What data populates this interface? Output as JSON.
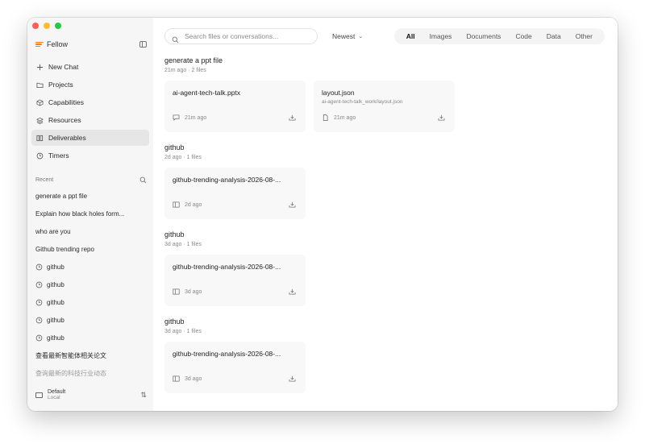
{
  "app": {
    "name": "Fellow"
  },
  "sidebar": {
    "nav": [
      {
        "label": "New Chat",
        "icon": "plus-icon"
      },
      {
        "label": "Projects",
        "icon": "folder-icon"
      },
      {
        "label": "Capabilities",
        "icon": "cube-icon"
      },
      {
        "label": "Resources",
        "icon": "layers-icon"
      },
      {
        "label": "Deliverables",
        "icon": "deliverables-icon",
        "active": true
      },
      {
        "label": "Timers",
        "icon": "clock-icon"
      }
    ],
    "recent_label": "Recent",
    "recent": [
      {
        "label": "generate a ppt file"
      },
      {
        "label": "Explain how black holes form..."
      },
      {
        "label": "who are you"
      },
      {
        "label": "Github trending repo"
      },
      {
        "label": "github",
        "icon": "clock-icon"
      },
      {
        "label": "github",
        "icon": "clock-icon"
      },
      {
        "label": "github",
        "icon": "clock-icon"
      },
      {
        "label": "github",
        "icon": "clock-icon"
      },
      {
        "label": "github",
        "icon": "clock-icon"
      },
      {
        "label": "查看最新智能体相关论文"
      },
      {
        "label": "查询最新的科技行业动态"
      }
    ],
    "footer": {
      "title": "Default",
      "subtitle": "Local"
    }
  },
  "topbar": {
    "search_placeholder": "Search files or conversations...",
    "sort_label": "Newest",
    "filters": [
      "All",
      "Images",
      "Documents",
      "Code",
      "Data",
      "Other"
    ],
    "active_filter": "All"
  },
  "groups": [
    {
      "title": "generate a ppt file",
      "meta": "21m ago · 2 files",
      "files": [
        {
          "name": "ai-agent-tech-talk.pptx",
          "path": "",
          "time": "21m ago",
          "kind_icon": "chat-icon"
        },
        {
          "name": "layout.json",
          "path": "ai-agent-tech-talk_work/layout.json",
          "time": "21m ago",
          "kind_icon": "file-icon"
        }
      ]
    },
    {
      "title": "github",
      "meta": "2d ago · 1 files",
      "files": [
        {
          "name": "github-trending-analysis-2026-08-...",
          "path": "",
          "time": "2d ago",
          "kind_icon": "book-icon"
        }
      ]
    },
    {
      "title": "github",
      "meta": "3d ago · 1 files",
      "files": [
        {
          "name": "github-trending-analysis-2026-08-...",
          "path": "",
          "time": "3d ago",
          "kind_icon": "book-icon"
        }
      ]
    },
    {
      "title": "github",
      "meta": "3d ago · 1 files",
      "files": [
        {
          "name": "github-trending-analysis-2026-08-...",
          "path": "",
          "time": "3d ago",
          "kind_icon": "book-icon"
        }
      ]
    }
  ]
}
